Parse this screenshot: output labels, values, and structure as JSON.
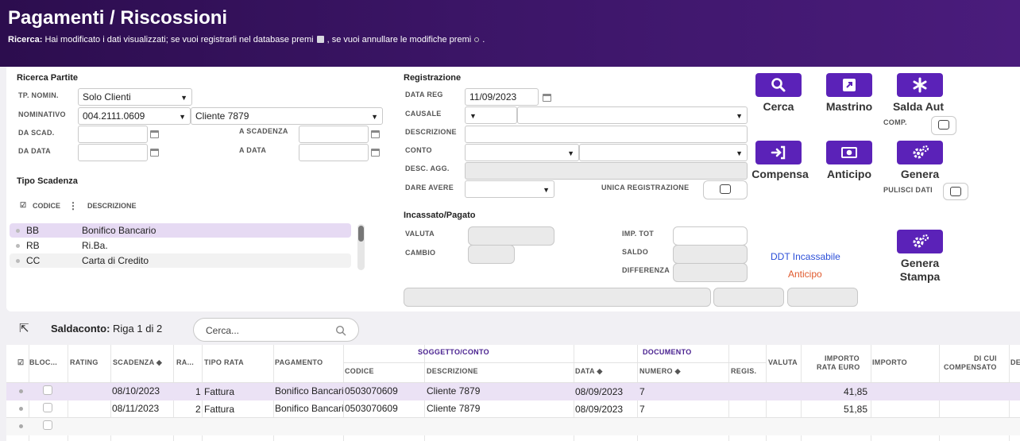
{
  "header": {
    "title": "Pagamenti / Riscossioni",
    "msg_label": "Ricerca:",
    "msg_part1": "Hai modificato i dati visualizzati; se vuoi registrarli nel database premi",
    "msg_part2": ", se vuoi annullare le modifiche premi",
    "msg_end": "."
  },
  "ricerca": {
    "section": "Ricerca Partite",
    "tp_nomin_label": "TP. NOMIN.",
    "tp_nomin_value": "Solo Clienti",
    "nominativo_label": "NOMINATIVO",
    "nominativo_code": "004.2111.0609",
    "nominativo_name": "Cliente 7879",
    "da_scad_label": "DA SCAD.",
    "a_scadenza_label": "A SCADENZA",
    "da_data_label": "DA DATA",
    "a_data_label": "A DATA"
  },
  "tipo_scadenza": {
    "section": "Tipo Scadenza",
    "col_codice": "CODICE",
    "col_descrizione": "DESCRIZIONE",
    "rows": [
      {
        "codice": "BB",
        "descrizione": "Bonifico Bancario"
      },
      {
        "codice": "RB",
        "descrizione": "Ri.Ba."
      },
      {
        "codice": "CC",
        "descrizione": "Carta di Credito"
      }
    ]
  },
  "registrazione": {
    "section": "Registrazione",
    "data_reg_label": "DATA REG",
    "data_reg_value": "11/09/2023",
    "causale_label": "CAUSALE",
    "descrizione_label": "DESCRIZIONE",
    "conto_label": "CONTO",
    "desc_agg_label": "DESC. AGG.",
    "dare_avere_label": "DARE AVERE",
    "unica_label": "UNICA REGISTRAZIONE"
  },
  "incassato": {
    "section": "Incassato/Pagato",
    "valuta_label": "VALUTA",
    "cambio_label": "CAMBIO",
    "imp_tot_label": "IMP. TOT",
    "saldo_label": "SALDO",
    "differenza_label": "DIFFERENZA",
    "ddt_link": "DDT Incassabile",
    "anticipo_link": "Anticipo"
  },
  "actions": {
    "cerca": "Cerca",
    "mastrino": "Mastrino",
    "saldа_aut": "Salda Aut",
    "comp_label": "COMP.",
    "compensa": "Compensa",
    "anticipo": "Anticipo",
    "genera": "Genera",
    "pulisci_label": "PULISCI DATI",
    "genera_stampa_1": "Genera",
    "genera_stampa_2": "Stampa"
  },
  "saldaconto": {
    "label": "Saldaconto:",
    "counter": "Riga 1 di 2",
    "search_placeholder": "Cerca..."
  },
  "grid": {
    "headers": {
      "bloc": "BLOC...",
      "rating": "RATING",
      "scadenza": "SCADENZA",
      "ra": "RA...",
      "tipo_rata": "TIPO RATA",
      "pagamento": "PAGAMENTO",
      "soggetto": "SOGGETTO/CONTO",
      "codice": "CODICE",
      "descrizione": "DESCRIZIONE",
      "documento": "DOCUMENTO",
      "data": "DATA",
      "numero": "NUMERO",
      "regis": "REGIS.",
      "valuta": "VALUTA",
      "importo_rata_1": "IMPORTO",
      "importo_rata_2": "RATA EURO",
      "importo": "IMPORTO",
      "di_cui_1": "DI CUI",
      "di_cui_2": "COMPENSATO",
      "de": "DE"
    },
    "rows": [
      {
        "scadenza": "08/10/2023",
        "ra": "1",
        "tipo_rata": "Fattura",
        "pagamento": "Bonifico Bancario",
        "codice": "0503070609",
        "descrizione": "Cliente 7879",
        "data": "08/09/2023",
        "numero": "7",
        "importo_rata": "41,85"
      },
      {
        "scadenza": "08/11/2023",
        "ra": "2",
        "tipo_rata": "Fattura",
        "pagamento": "Bonifico Bancario",
        "codice": "0503070609",
        "descrizione": "Cliente 7879",
        "data": "08/09/2023",
        "numero": "7",
        "importo_rata": "51,85"
      }
    ]
  },
  "colors": {
    "accent": "#5b22b8",
    "header": "#3b1566",
    "selected_row": "#ebe2f5"
  }
}
